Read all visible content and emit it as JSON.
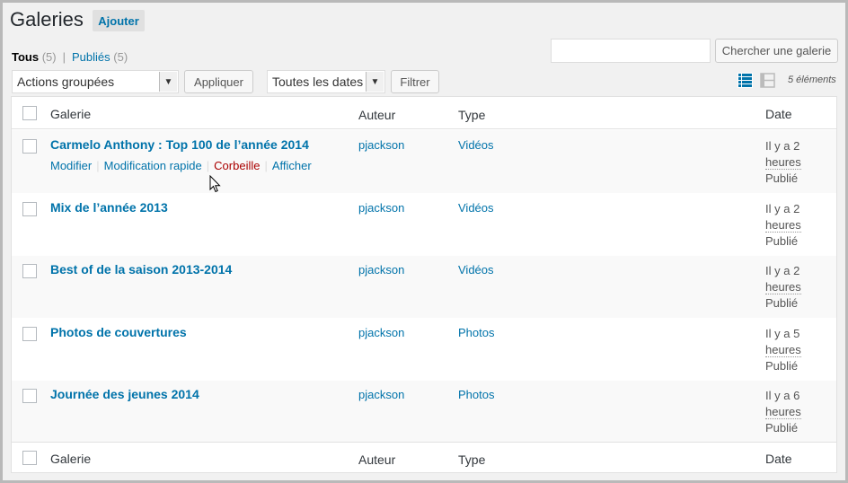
{
  "page": {
    "title": "Galeries",
    "add_label": "Ajouter"
  },
  "filters": {
    "all_label": "Tous",
    "all_count": "(5)",
    "separator": "|",
    "published_label": "Publiés",
    "published_count": "(5)"
  },
  "search": {
    "value": "",
    "button_label": "Chercher une galerie"
  },
  "toolbar": {
    "bulk_actions_value": "Actions groupées",
    "apply_label": "Appliquer",
    "date_value": "Toutes les dates",
    "filter_label": "Filtrer",
    "items_count": "5 éléments"
  },
  "columns": {
    "title": "Galerie",
    "author": "Auteur",
    "type": "Type",
    "date": "Date"
  },
  "row_actions": {
    "edit": "Modifier",
    "quick_edit": "Modification rapide",
    "trash": "Corbeille",
    "view": "Afficher",
    "separator": "|"
  },
  "rows": [
    {
      "title": "Carmelo Anthony : Top 100 de l’année 2014",
      "author": "pjackson",
      "type": "Vidéos",
      "date_line1": "Il y a 2",
      "date_line2": "heures",
      "status": "Publié"
    },
    {
      "title": "Mix de l’année 2013",
      "author": "pjackson",
      "type": "Vidéos",
      "date_line1": "Il y a 2",
      "date_line2": "heures",
      "status": "Publié"
    },
    {
      "title": "Best of de la saison 2013-2014",
      "author": "pjackson",
      "type": "Vidéos",
      "date_line1": "Il y a 2",
      "date_line2": "heures",
      "status": "Publié"
    },
    {
      "title": "Photos de couvertures",
      "author": "pjackson",
      "type": "Photos",
      "date_line1": "Il y a 5",
      "date_line2": "heures",
      "status": "Publié"
    },
    {
      "title": "Journée des jeunes 2014",
      "author": "pjackson",
      "type": "Photos",
      "date_line1": "Il y a 6",
      "date_line2": "heures",
      "status": "Publié"
    }
  ],
  "icons": {
    "list_view": "list-view-icon",
    "excerpt_view": "excerpt-view-icon",
    "dropdown": "chevron-down-icon",
    "cursor": "mouse-pointer-icon"
  },
  "colors": {
    "link": "#0073aa",
    "trash": "#aa0000",
    "background": "#f1f1f1"
  }
}
